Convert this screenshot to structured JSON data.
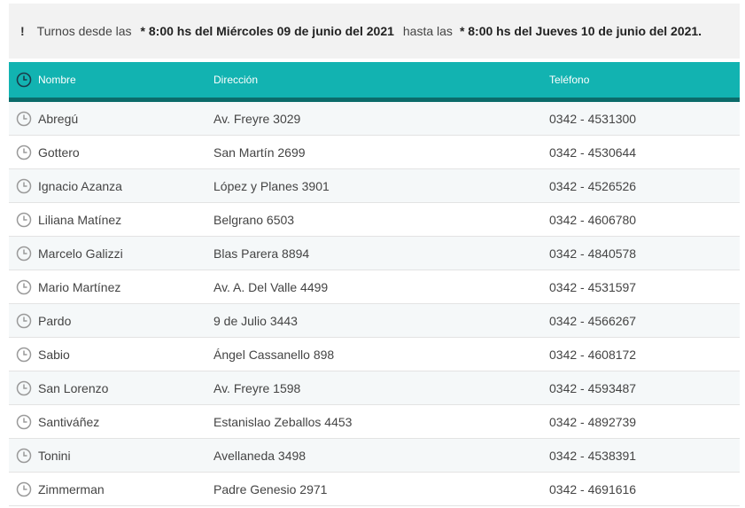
{
  "notice": {
    "icon": "!",
    "prefix": "Turnos desde las",
    "from": "* 8:00 hs del Miércoles 09 de junio del 2021",
    "middle": "hasta las",
    "to": "* 8:00 hs del Jueves 10 de junio del 2021."
  },
  "table": {
    "headers": {
      "name": "Nombre",
      "address": "Dirección",
      "phone": "Teléfono"
    },
    "header_icon": "clock-icon",
    "row_icon": "clock-icon",
    "colors": {
      "header_bg": "#12b3b1",
      "header_border": "#0b6b6a",
      "row_alt_bg": "#f5f8f9"
    },
    "rows": [
      {
        "name": "Abregú",
        "address": "Av. Freyre 3029",
        "phone": "0342 - 4531300"
      },
      {
        "name": "Gottero",
        "address": "San Martín 2699",
        "phone": "0342 - 4530644"
      },
      {
        "name": "Ignacio Azanza",
        "address": "López y Planes 3901",
        "phone": "0342 - 4526526"
      },
      {
        "name": "Liliana Matínez",
        "address": "Belgrano 6503",
        "phone": "0342 - 4606780"
      },
      {
        "name": "Marcelo Galizzi",
        "address": "Blas Parera 8894",
        "phone": "0342 - 4840578"
      },
      {
        "name": "Mario Martínez",
        "address": "Av. A. Del Valle 4499",
        "phone": "0342 - 4531597"
      },
      {
        "name": "Pardo",
        "address": "9 de Julio 3443",
        "phone": "0342 - 4566267"
      },
      {
        "name": "Sabio",
        "address": "Ángel Cassanello 898",
        "phone": "0342 - 4608172"
      },
      {
        "name": "San Lorenzo",
        "address": "Av. Freyre 1598",
        "phone": "0342 - 4593487"
      },
      {
        "name": "Santiváñez",
        "address": "Estanislao Zeballos 4453",
        "phone": "0342 - 4892739"
      },
      {
        "name": "Tonini",
        "address": "Avellaneda 3498",
        "phone": "0342 - 4538391"
      },
      {
        "name": "Zimmerman",
        "address": "Padre Genesio 2971",
        "phone": "0342 - 4691616"
      }
    ]
  }
}
